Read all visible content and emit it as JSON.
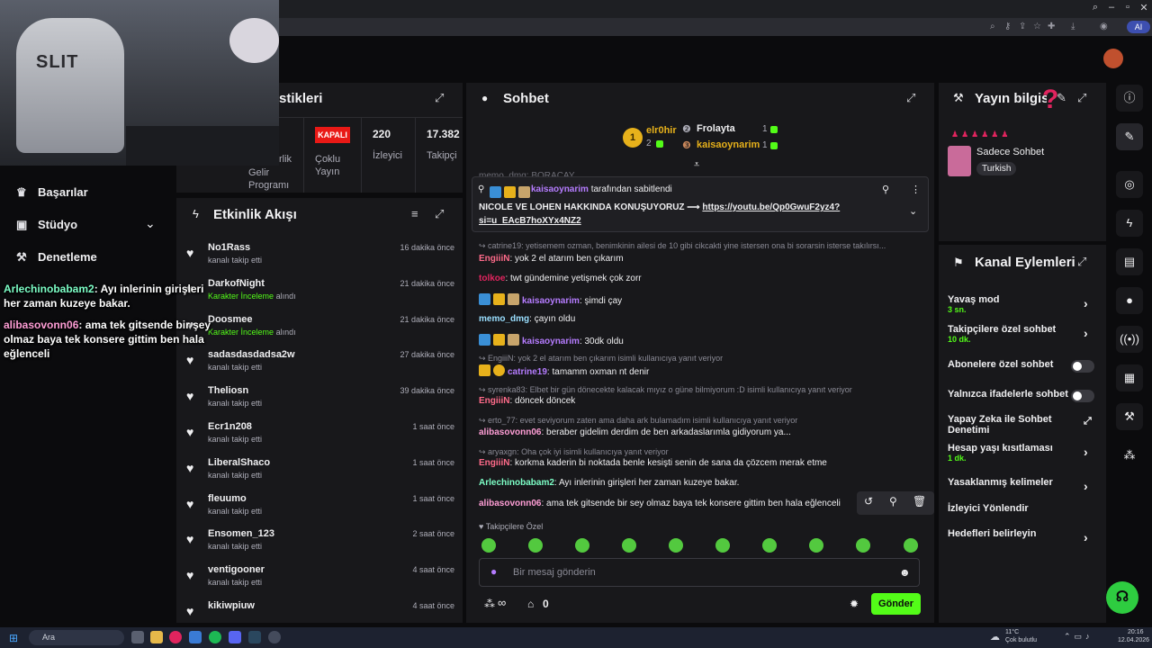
{
  "browser": {
    "tab_icons": [
      "zoom-icon",
      "key-icon",
      "share-icon",
      "star-icon",
      "puzzle-icon",
      "download-icon",
      "profile-icon"
    ],
    "ai_label": "AI"
  },
  "left_nav": {
    "items": [
      {
        "label": "Başarılar",
        "icon": "trophy-icon"
      },
      {
        "label": "Stüdyo",
        "icon": "studio-icon"
      },
      {
        "label": "Denetleme",
        "icon": "hammer-icon"
      }
    ]
  },
  "overlay_chat": [
    {
      "user": "Arlechinobabam2",
      "text": ": Ayı inlerinin girişleri her zaman kuzeye bakar."
    },
    {
      "user": "alibasovonn06",
      "text": ": ama tek gitsende bir şey olmaz baya tek konsere gittim ben hala eğlenceli"
    }
  ],
  "stats_panel": {
    "title_fragment": "stikleri",
    "items": [
      {
        "label": "Gelir Programı",
        "value": "rlik"
      },
      {
        "badge": "KAPALI",
        "label": "Çoklu Yayın"
      },
      {
        "value": "220",
        "label": "İzleyici"
      },
      {
        "value": "17.382",
        "label": "Takipçi"
      }
    ]
  },
  "activity": {
    "title": "Etkinlik Akışı",
    "rows": [
      {
        "name": "No1Rass",
        "sub": "kanalı takip etti",
        "time": "16 dakika önce"
      },
      {
        "name": "DarkofNight",
        "sub_highlight": "Karakter İnceleme",
        "sub": "alındı",
        "time": "21 dakika önce"
      },
      {
        "name": "Doosmee",
        "sub_highlight": "Karakter İnceleme",
        "sub": "alındı",
        "time": "21 dakika önce"
      },
      {
        "name": "sadasdasdadsa2w",
        "sub": "kanalı takip etti",
        "time": "27 dakika önce"
      },
      {
        "name": "Theliosn",
        "sub": "kanalı takip etti",
        "time": "39 dakika önce"
      },
      {
        "name": "Ecr1n208",
        "sub": "kanalı takip etti",
        "time": "1 saat önce"
      },
      {
        "name": "LiberalShaco",
        "sub": "kanalı takip etti",
        "time": "1 saat önce"
      },
      {
        "name": "fleuumo",
        "sub": "kanalı takip etti",
        "time": "1 saat önce"
      },
      {
        "name": "Ensomen_123",
        "sub": "kanalı takip etti",
        "time": "2 saat önce"
      },
      {
        "name": "ventigooner",
        "sub": "kanalı takip etti",
        "time": "4 saat önce"
      },
      {
        "name": "kikiwpiuw",
        "sub": "",
        "time": "4 saat önce"
      }
    ]
  },
  "chat": {
    "title": "Sohbet",
    "leaderboard": [
      {
        "rank": "1",
        "name": "elr0hir",
        "count": "2"
      },
      {
        "name": "Frolayta",
        "count": "1"
      },
      {
        "name": "kaisaoynarim",
        "count": "1"
      }
    ],
    "cut_line": "memo_dmg: BORACAY",
    "pinned": {
      "by_user": "kaisaoynarim",
      "by_text": "tarafından sabitlendi",
      "message": "NICOLE VE LOHEN HAKKINDA KONUŞUYORUZ ⟶",
      "link": "https://youtu.be/Qp0GwuF2yz4?si=u_EAcB7hoXYx4NZ2"
    },
    "messages": [
      {
        "reply": "catrine19: yetisemem ozman, benimkinin ailesi de 10 gibi cikcakti yine istersen ona bi sorarsin isterse takılırsı..."
      },
      {
        "user": "EngiiiN",
        "color": "#ff6b8a",
        "text": "yok 2 el atarım ben çıkarım"
      },
      {
        "user": "tolkoe",
        "color": "#e0245e",
        "text": "twt gündemine yetişmek çok zorr"
      },
      {
        "user": "kaisaoynarim",
        "color": "#b57cff",
        "badges": true,
        "text": "şimdi çay"
      },
      {
        "user": "memo_dmg",
        "color": "#9adfff",
        "text": "çayın oldu"
      },
      {
        "user": "kaisaoynarim",
        "color": "#b57cff",
        "badges": true,
        "text": "30dk oldu"
      },
      {
        "reply": "EngiiiN: yok 2 el atarım ben çıkarım isimli kullanıcıya yanıt veriyor"
      },
      {
        "user": "catrine19",
        "color": "#b57cff",
        "coin": true,
        "text": "tamamm oxman nt denir"
      },
      {
        "reply": "syrenka83: Elbet bir gün dönecekte kalacak mıyız o güne bilmiyorum :D isimli kullanıcıya yanıt veriyor"
      },
      {
        "user": "EngiiiN",
        "color": "#ff6b8a",
        "text": "döncek döncek"
      },
      {
        "reply": "erto_77: evet seviyorum zaten ama daha ark bulamadım isimli kullanıcıya yanıt veriyor"
      },
      {
        "user": "alibasovonn06",
        "color": "#ff9ed6",
        "text": "beraber gidelim derdim de ben arkadaslarımla gidiyorum ya..."
      },
      {
        "reply": "aryaxgn: Oha çok iyi isimli kullanıcıya yanıt veriyor"
      },
      {
        "user": "EngiiiN",
        "color": "#ff6b8a",
        "text": "korkma kaderin bi noktada benle kesişti senin de sana da çözcem merak etme"
      },
      {
        "user": "Arlechinobabam2",
        "color": "#7dffc7",
        "text": "Ayı inlerinin girişleri her zaman kuzeye bakar."
      },
      {
        "user": "alibasovonn06",
        "color": "#ff9ed6",
        "text": "ama tek gitsende bir sey olmaz baya tek konsere gittim ben hala eğlenceli"
      }
    ],
    "emote_section": "Takipçilere Özel",
    "input_placeholder": "Bir mesaj gönderin",
    "infinity": "∞",
    "points": "0",
    "send_label": "Gönder"
  },
  "stream_info": {
    "title": "Yayın bilgisi",
    "category": "Sadece Sohbet",
    "language": "Turkish"
  },
  "channel_actions": {
    "title": "Kanal Eylemleri",
    "items": [
      {
        "label": "Yavaş mod",
        "sub": "3 sn.",
        "control": "chevron"
      },
      {
        "label": "Takipçilere özel sohbet",
        "sub": "10 dk.",
        "control": "chevron"
      },
      {
        "label": "Abonelere özel sohbet",
        "control": "toggle"
      },
      {
        "label": "Yalnızca ifadelerle sohbet",
        "control": "toggle"
      },
      {
        "label": "Yapay Zeka ile Sohbet Denetimi",
        "control": "external"
      },
      {
        "label": "Hesap yaşı kısıtlaması",
        "sub": "1 dk.",
        "control": "chevron"
      },
      {
        "label": "Yasaklanmış kelimeler",
        "control": "chevron"
      },
      {
        "label": "İzleyici Yönlendir",
        "control": "none"
      },
      {
        "label": "Hedefleri belirleyin",
        "control": "chevron"
      }
    ]
  },
  "taskbar": {
    "search": "Ara",
    "weather": "11°C",
    "weather_sub": "Çok bulutlu",
    "time": "20:16",
    "date": "12.04.2026"
  },
  "colors": {
    "accent": "#53fc18",
    "panel": "#18181b",
    "bg": "#0b0b0d",
    "badge_red": "#e91916"
  }
}
